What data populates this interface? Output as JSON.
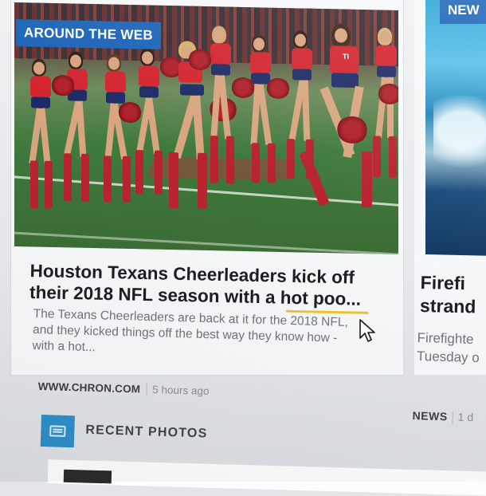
{
  "main_card": {
    "badge": "AROUND THE WEB",
    "headline_line1": "Houston Texans Cheerleaders kick off",
    "headline_line2": "their 2018 NFL season with a hot poo...",
    "summary_line1": "The Texans Cheerleaders are back at it for the 2018 NFL,",
    "summary_line2": "and they kicked things off the best way they know how -",
    "summary_line3": "with a hot...",
    "source": "WWW.CHRON.COM",
    "time": "5 hours ago",
    "jersey_text": "TI"
  },
  "side_card": {
    "badge": "NEW",
    "headline_line1": "Firefi",
    "headline_line2": "strand",
    "summary_line1": "Firefighte",
    "summary_line2": "Tuesday o",
    "category": "NEWS",
    "time": "1 d"
  },
  "recent_photos": {
    "label": "RECENT PHOTOS",
    "icon": "photo-gallery-icon"
  },
  "colors": {
    "badge_blue": "#1b63b7",
    "accent_underline": "#f1c232",
    "recent_icon_blue": "#2f8ec9"
  }
}
